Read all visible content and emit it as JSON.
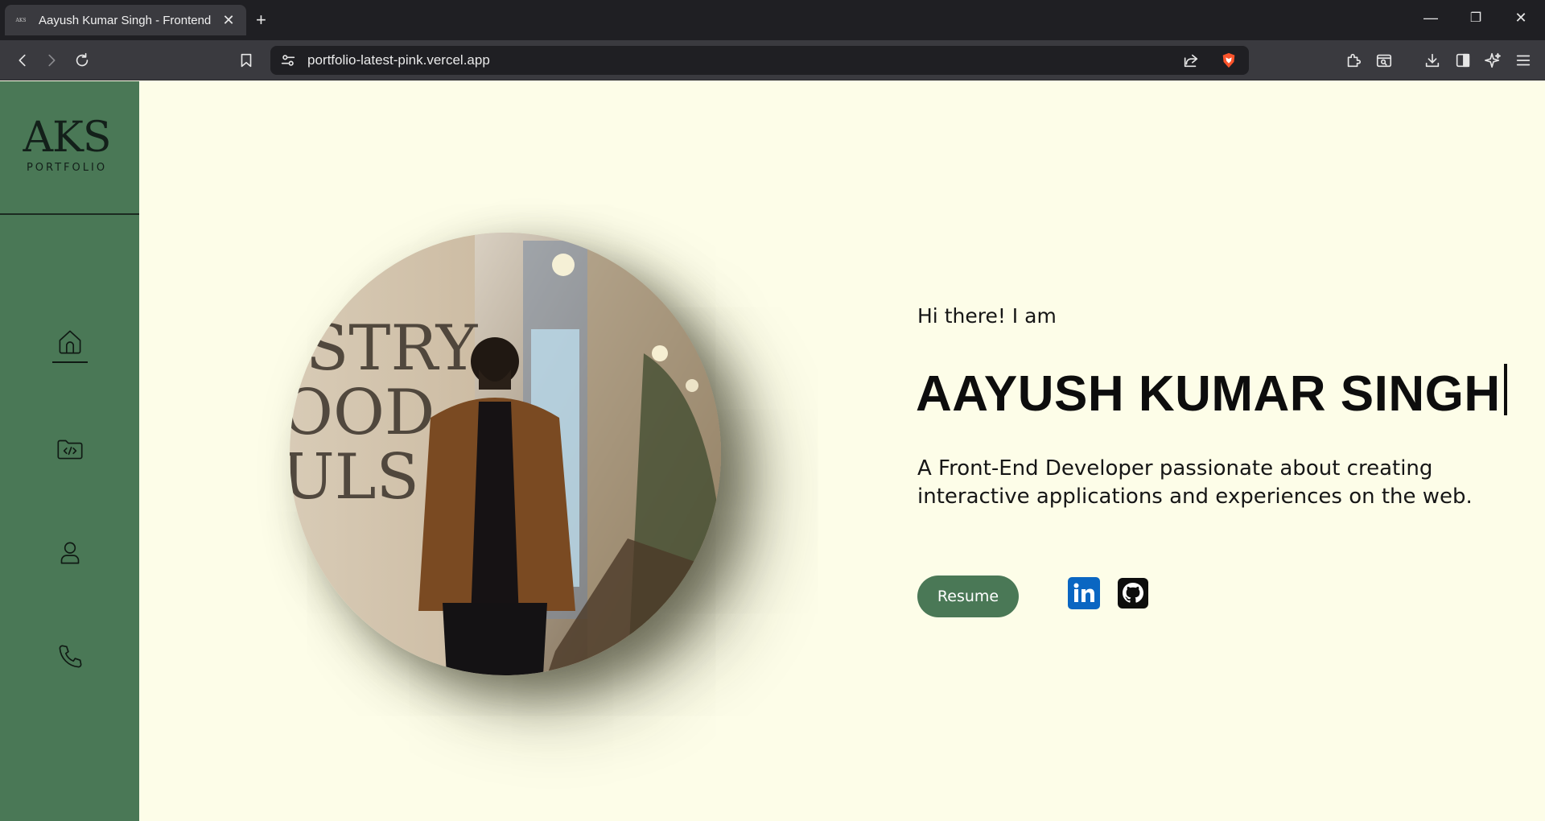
{
  "browser": {
    "tab": {
      "favicon_text": "AKS",
      "title": "Aayush Kumar Singh - Frontend"
    },
    "url": "portfolio-latest-pink.vercel.app",
    "icons": [
      "back-icon",
      "forward-icon",
      "reload-icon",
      "bookmark-icon",
      "site-info-icon",
      "share-icon",
      "brave-shield-icon",
      "extensions-icon",
      "leo-search-icon",
      "downloads-icon",
      "sidebar-icon",
      "leo-ai-icon",
      "menu-icon"
    ]
  },
  "sidebar": {
    "logo": {
      "mark": "AKS",
      "subtitle": "PORTFOLIO"
    },
    "nav": [
      "home-icon",
      "projects-folder-icon",
      "about-person-icon",
      "contact-phone-icon"
    ],
    "active": "home",
    "background": "#4a7856"
  },
  "hero": {
    "greeting": "Hi there! I am",
    "name": "AAYUSH KUMAR SINGH",
    "description": "A Front-End Developer passionate about creating interactive applications and experiences on the web.",
    "resume_label": "Resume",
    "social": [
      "linkedin-icon",
      "github-icon"
    ]
  },
  "colors": {
    "page_bg": "#fdfde8",
    "accent": "#4a7856",
    "linkedin": "#0a66c2"
  }
}
